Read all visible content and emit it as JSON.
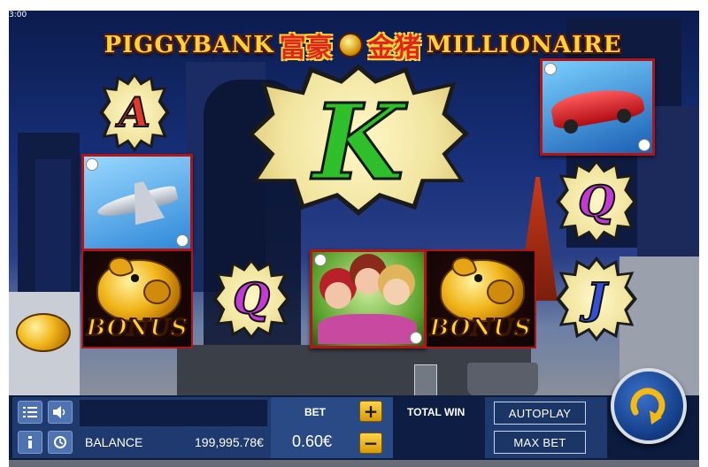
{
  "status": {
    "clock": "3:00"
  },
  "game": {
    "title_left": "PIGGYBANK",
    "title_chinese_1": "富豪",
    "title_chinese_2": "金猪",
    "title_right": "MILLIONAIRE"
  },
  "reels": {
    "big_symbol": "K",
    "symbols": [
      {
        "id": "A",
        "kind": "letter",
        "color": "#e23a2a"
      },
      {
        "id": "Q",
        "kind": "letter",
        "color": "#c13ad6"
      },
      {
        "id": "Q",
        "kind": "letter",
        "color": "#c13ad6"
      },
      {
        "id": "J",
        "kind": "letter",
        "color": "#3250d8"
      },
      {
        "id": "K",
        "kind": "letter",
        "color": "#2fbf2a"
      }
    ],
    "bonus_label": "BONUS",
    "bonus_pig_chinese": "金猪",
    "card_icons": [
      "sports-car",
      "private-jet",
      "three-women"
    ]
  },
  "controls": {
    "balance_label": "BALANCE",
    "balance_value": "199,995.78€",
    "bet_label": "BET",
    "bet_value": "0.60€",
    "total_win_label": "TOTAL WIN",
    "total_win_value": "",
    "autoplay_label": "AUTOPLAY",
    "maxbet_label": "MAX BET",
    "plus": "+",
    "minus": "−"
  },
  "colors": {
    "accent_gold": "#ffd23a",
    "panel_blue": "#233f73",
    "card_red": "#b41414"
  }
}
